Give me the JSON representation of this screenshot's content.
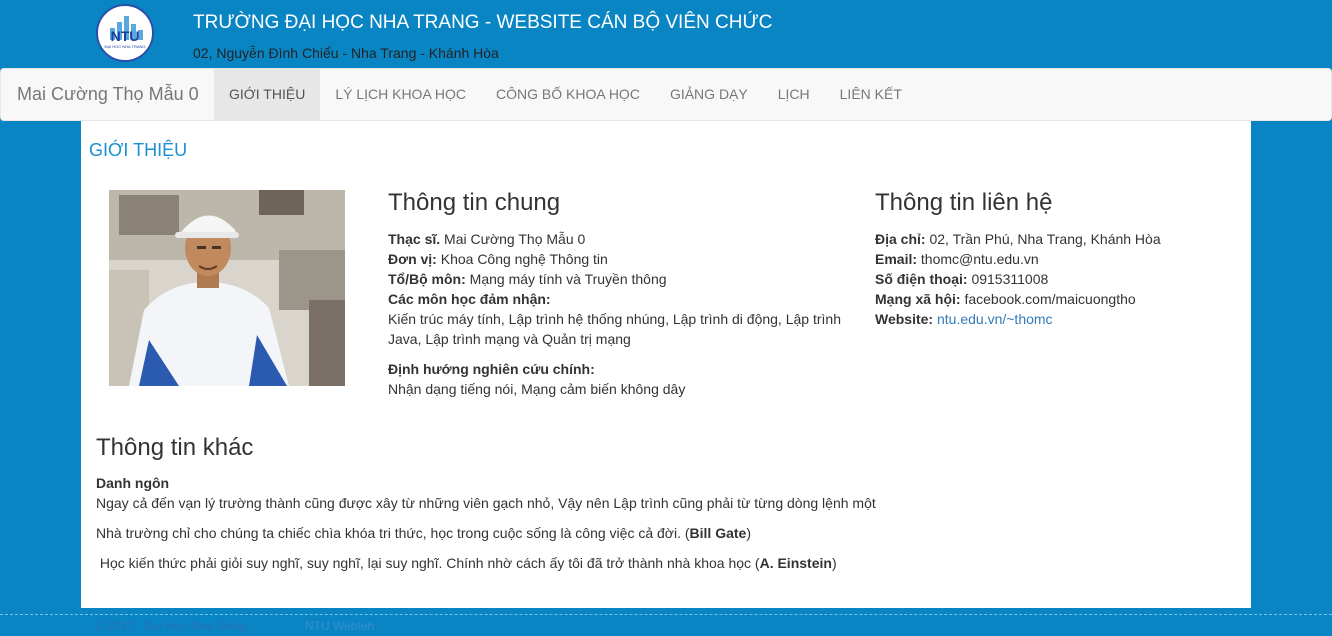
{
  "header": {
    "logo_text": "NTU",
    "logo_subtext": "ĐẠI HỌC NHA TRANG",
    "title": "TRƯỜNG ĐẠI HỌC NHA TRANG - WEBSITE CÁN BỘ VIÊN CHỨC",
    "address": "02, Nguyễn Đình Chiểu - Nha Trang - Khánh Hòa"
  },
  "nav": {
    "brand": "Mai Cường Thọ Mẫu 0",
    "items": [
      {
        "label": "GIỚI THIỆU"
      },
      {
        "label": "LÝ LỊCH KHOA HỌC"
      },
      {
        "label": "CÔNG BỐ KHOA HỌC"
      },
      {
        "label": "GIẢNG DẠY"
      },
      {
        "label": "LỊCH"
      },
      {
        "label": "LIÊN KẾT"
      }
    ],
    "active_index": 0
  },
  "main": {
    "section_title": "GIỚI THIỆU",
    "general": {
      "heading": "Thông tin chung",
      "degree_label": "Thạc sĩ.",
      "degree_value": "Mai Cường Thọ Mẫu 0",
      "unit_label": "Đơn vị:",
      "unit_value": "Khoa Công nghệ Thông tin",
      "dept_label": "Tổ/Bộ môn:",
      "dept_value": "Mạng máy tính và Truyền thông",
      "courses_label": "Các môn học đảm nhận:",
      "courses_value": "Kiến trúc máy tính, Lập trình hệ thống nhúng, Lập trình di động, Lập trình Java, Lập trình mạng và Quản trị mạng",
      "research_label": "Định hướng nghiên cứu chính:",
      "research_value": "Nhận dạng tiếng nói, Mạng cảm biến không dây"
    },
    "contact": {
      "heading": "Thông tin liên hệ",
      "address_label": "Địa chỉ:",
      "address_value": "02, Trần Phú, Nha Trang, Khánh Hòa",
      "email_label": "Email:",
      "email_value": "thomc@ntu.edu.vn",
      "phone_label": "Số điện thoại:",
      "phone_value": "0915311008",
      "social_label": "Mạng xã hội:",
      "social_value": "facebook.com/maicuongtho",
      "website_label": "Website:",
      "website_value": "ntu.edu.vn/~thomc"
    },
    "other": {
      "heading": "Thông tin khác",
      "quotes_label": "Danh ngôn",
      "quote1": "Ngay cả đến vạn lý trường thành cũng được xây từ những viên gạch nhỏ, Vậy nên Lập trình cũng phải từ từng dòng lệnh một",
      "quote2_text": "Nhà trường chỉ cho chúng ta chiếc chìa khóa tri thức, học trong cuộc sống là công việc cả đời. (",
      "quote2_author": "Bill Gate",
      "quote2_close": ")",
      "quote3_text": " Học kiến thức phải giỏi suy nghĩ, suy nghĩ, lại suy nghĩ. Chính nhờ cách ấy tôi đã trở thành nhà khoa học (",
      "quote3_author": "A. Einstein",
      "quote3_close": ")"
    }
  },
  "footer": {
    "copyright": "© 2017 - Đại Học Nha Trang",
    "secondary": "NTU Webteh"
  },
  "colors": {
    "background": "#0a85c4",
    "accent": "#1a8fd1",
    "link": "#337ab7"
  }
}
